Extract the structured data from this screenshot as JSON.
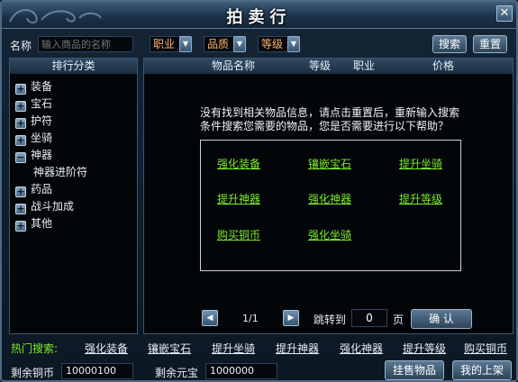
{
  "window": {
    "title": "拍卖行"
  },
  "search": {
    "name_label": "名称",
    "name_placeholder": "输入商品的名称",
    "profession_label": "职业",
    "quality_label": "品质",
    "level_label": "等级",
    "search_button": "搜索",
    "reset_button": "重置"
  },
  "categories": {
    "header": "排行分类",
    "items": [
      {
        "label": "装备",
        "state": "+"
      },
      {
        "label": "宝石",
        "state": "+"
      },
      {
        "label": "护符",
        "state": "+"
      },
      {
        "label": "坐骑",
        "state": "+"
      },
      {
        "label": "神器",
        "state": "−"
      },
      {
        "label": "药品",
        "state": "+"
      },
      {
        "label": "战斗加成",
        "state": "+"
      },
      {
        "label": "其他",
        "state": "+"
      }
    ],
    "subitem": "神器进阶符"
  },
  "listing": {
    "columns": [
      "物品名称",
      "等级",
      "职业",
      "价格"
    ],
    "notice_line1": "没有找到相关物品信息，请点击重置后，重新输入搜索",
    "notice_line2": "条件搜索您需要的物品，您是否需要进行以下帮助？",
    "help_links": [
      "强化装备",
      "镶嵌宝石",
      "提升坐骑",
      "提升神器",
      "强化神器",
      "提升等级",
      "购买铜币",
      "强化坐骑"
    ]
  },
  "pagination": {
    "page_info": "1/1",
    "jump_label": "跳转到",
    "page_value": "0",
    "page_unit": "页",
    "confirm_button": "确  认"
  },
  "hot_search": {
    "label": "热门搜索:",
    "items": [
      "强化装备",
      "镶嵌宝石",
      "提升坐骑",
      "提升神器",
      "强化神器",
      "提升等级",
      "购买铜币"
    ]
  },
  "footer": {
    "copper_label": "剩余铜币",
    "copper_value": "10000100",
    "yuanbao_label": "剩余元宝",
    "yuanbao_value": "1000000",
    "sell_button": "挂售物品",
    "my_listings_button": "我的上架"
  },
  "icons": {
    "close": "close-icon",
    "dropdown": "chevron-down-icon",
    "prev": "prev-page-icon",
    "next": "next-page-icon"
  }
}
